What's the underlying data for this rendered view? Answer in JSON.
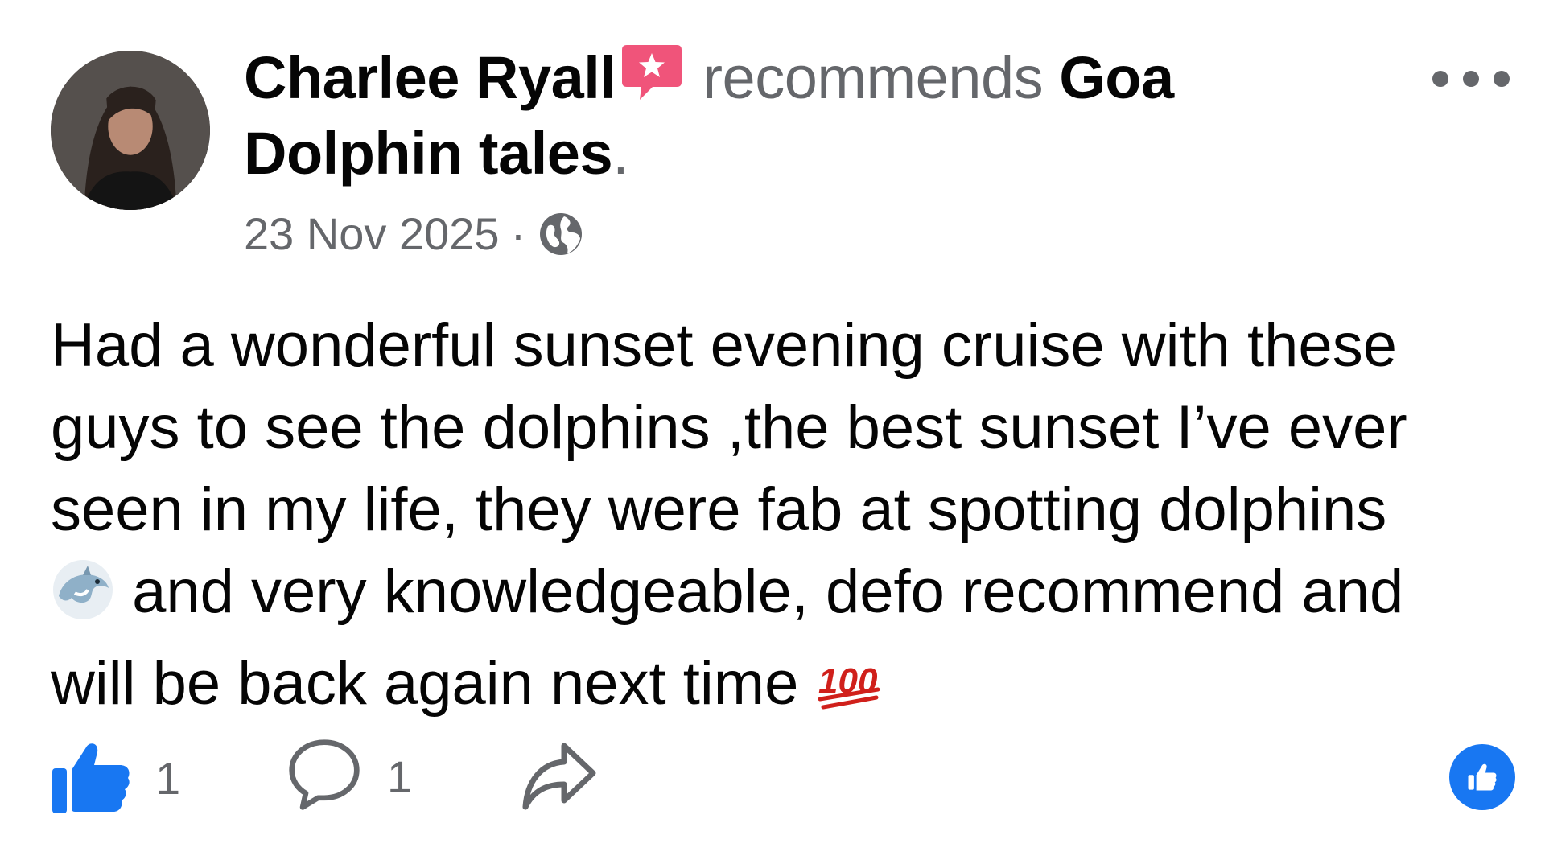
{
  "post": {
    "author": "Charlee Ryall",
    "verb": "recommends",
    "page": "Goa Dolphin tales",
    "period": ".",
    "date": "23 Nov 2025",
    "separator": "·",
    "privacy_icon": "globe-icon",
    "badge_icon": "recommendation-badge-icon",
    "body": {
      "part1": "Had a wonderful sunset evening cruise with these\nguys to see the dolphins ,the best sunset I’ve ever\nseen in my life, they were fab at spotting dolphins\n",
      "emoji1": "dolphin",
      "part2": " and very knowledgeable, defo recommend and\nwill be back again next time ",
      "emoji2": "hundred-points"
    }
  },
  "actions": {
    "like_count": "1",
    "comment_count": "1",
    "share_icon": "share-icon",
    "reaction_icon": "like-reaction-icon"
  },
  "colors": {
    "accent": "#1877f2",
    "secondary_text": "#65676b",
    "badge": "#f02849"
  }
}
